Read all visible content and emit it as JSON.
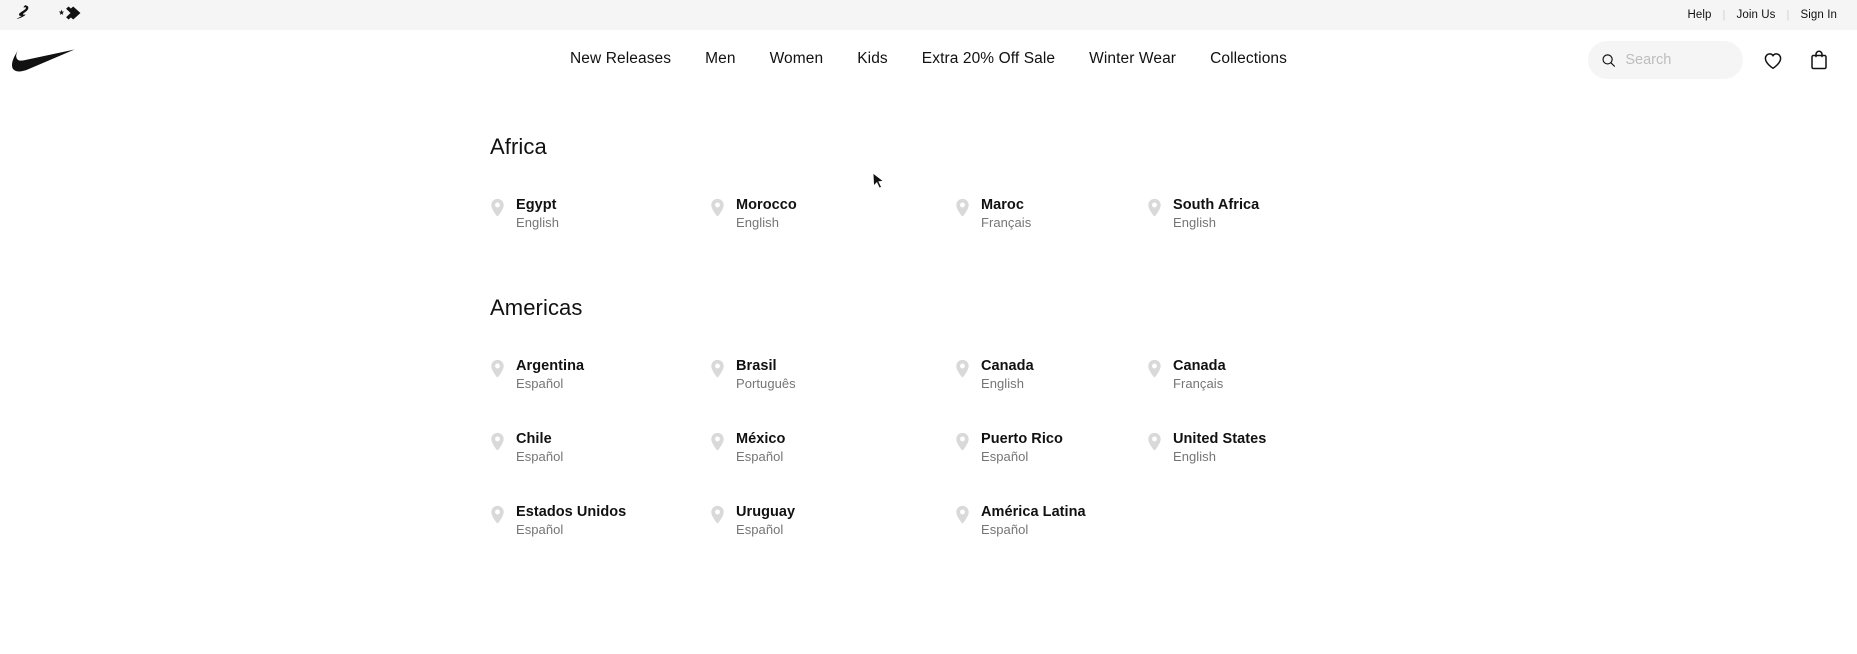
{
  "utility_bar": {
    "brands": [
      {
        "name": "jordan-logo",
        "label": "Jordan"
      },
      {
        "name": "converse-logo",
        "label": "Converse"
      }
    ],
    "links": [
      {
        "label": "Help"
      },
      {
        "label": "Join Us"
      },
      {
        "label": "Sign In"
      }
    ],
    "separator": "|",
    "background": "#f5f5f5"
  },
  "header": {
    "logo": "nike-swoosh",
    "nav": [
      {
        "label": "New Releases"
      },
      {
        "label": "Men"
      },
      {
        "label": "Women"
      },
      {
        "label": "Kids"
      },
      {
        "label": "Extra 20% Off Sale"
      },
      {
        "label": "Winter Wear"
      },
      {
        "label": "Collections"
      }
    ],
    "search": {
      "placeholder": "Search",
      "value": "",
      "icon": "search-icon"
    },
    "favorites_icon": "heart-icon",
    "bag_icon": "bag-icon"
  },
  "regions": [
    {
      "title": "Africa",
      "countries": [
        {
          "name": "Egypt",
          "language": "English"
        },
        {
          "name": "Morocco",
          "language": "English"
        },
        {
          "name": "Maroc",
          "language": "Français"
        },
        {
          "name": "South Africa",
          "language": "English"
        }
      ]
    },
    {
      "title": "Americas",
      "countries": [
        {
          "name": "Argentina",
          "language": "Español"
        },
        {
          "name": "Brasil",
          "language": "Português"
        },
        {
          "name": "Canada",
          "language": "English"
        },
        {
          "name": "Canada",
          "language": "Français"
        },
        {
          "name": "Chile",
          "language": "Español"
        },
        {
          "name": "México",
          "language": "Español"
        },
        {
          "name": "Puerto Rico",
          "language": "Español"
        },
        {
          "name": "United States",
          "language": "English"
        },
        {
          "name": "Estados Unidos",
          "language": "Español"
        },
        {
          "name": "Uruguay",
          "language": "Español"
        },
        {
          "name": "América Latina",
          "language": "Español"
        }
      ]
    }
  ],
  "colors": {
    "text_primary": "#111111",
    "text_secondary": "#757575",
    "pin": "#d9d9d9",
    "surface": "#f5f5f5"
  }
}
